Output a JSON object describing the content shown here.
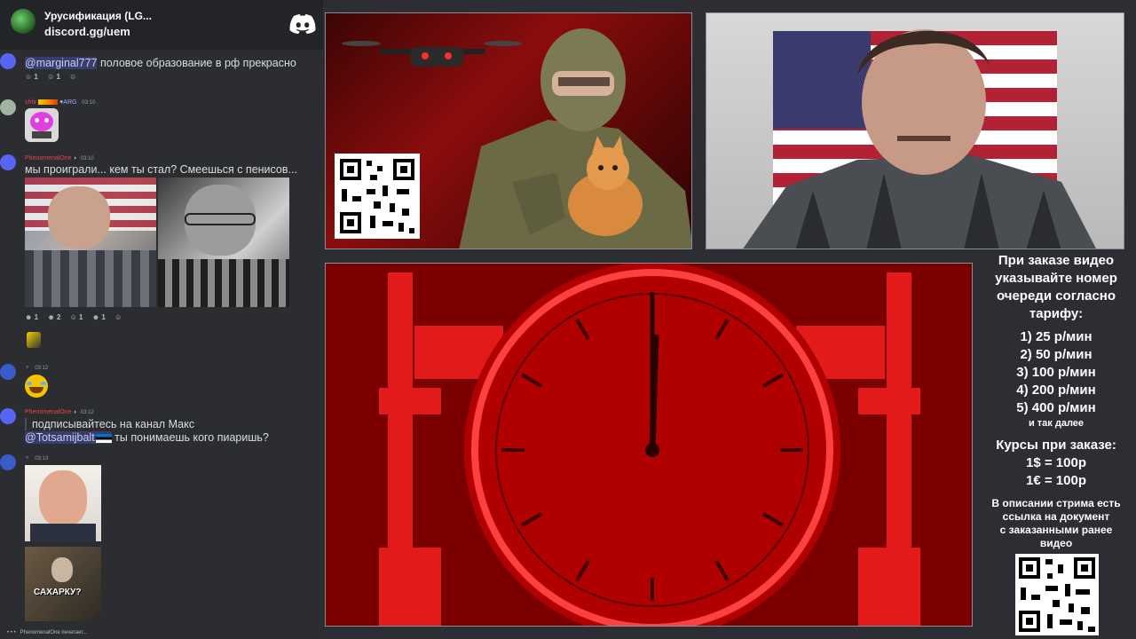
{
  "server": {
    "name": "Урусификация (LG...",
    "invite": "discord.gg/uem"
  },
  "messages": [
    {
      "text_mention": "@marginal777",
      "text": " половое образование в рф прекрасно",
      "reactions": [
        "1",
        "1"
      ]
    },
    {
      "author": "shtir",
      "badge": "ARG",
      "time": "03:10"
    },
    {
      "author": "PhenomenalOne",
      "time": "03:10",
      "text": "мы проиграли...  кем ты стал? Смеешься с пенисов...",
      "reactions": [
        "1",
        "2",
        "1",
        "1"
      ]
    },
    {
      "time": "03:12"
    },
    {
      "author": "PhenomenalOne",
      "time": "03:12",
      "text_line1": "подписывайтесь на канал Макс",
      "text_mention": "@Totsamijbalt",
      "text_line2": " ты понимаешь кого пиаришь?"
    },
    {
      "time": "03:13",
      "sticker_caption": "САХАРКУ?"
    }
  ],
  "typing": "PhenomenalOne печатает...",
  "info": {
    "heading": [
      "При заказе видео",
      "указывайте номер",
      "очереди согласно",
      "тарифу:"
    ],
    "tariffs": [
      "1) 25 р/мин",
      "2) 50 р/мин",
      "3) 100 р/мин",
      "4) 200 р/мин",
      "5) 400 р/мин"
    ],
    "tariffs_more": "и так далее",
    "rates_title": "Курсы при заказе:",
    "rates": [
      "1$ = 100р",
      "1€ = 100р"
    ],
    "doc_note": [
      "В описании стрима есть",
      "ссылка на документ",
      "с заказанными ранее",
      "видео"
    ]
  },
  "colors": {
    "chat_bg": "#2b2d31",
    "page_bg": "#2c2e33",
    "author_red": "#e8414c",
    "mention_bg": "#5865f2",
    "clock_red": "#b00000"
  },
  "icons": {
    "discord": "discord-logo-icon",
    "server": "server-avatar-icon"
  }
}
